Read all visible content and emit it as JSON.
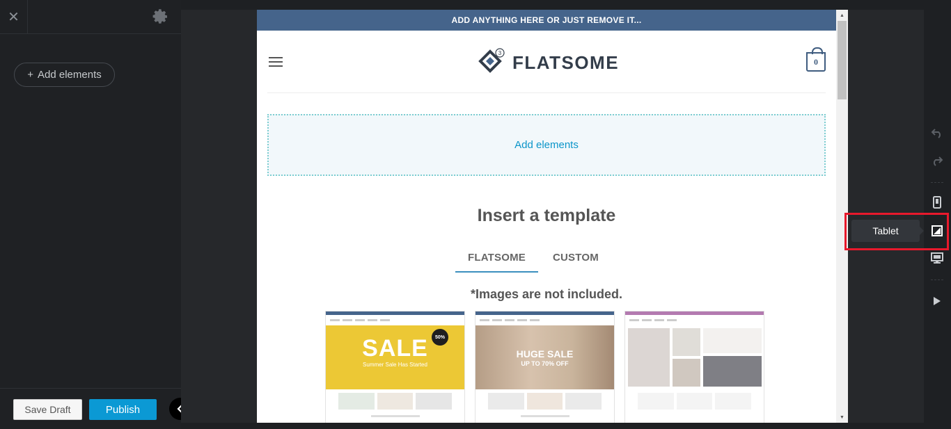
{
  "sidebar": {
    "close_icon": "close-icon",
    "settings_icon": "gear-icon",
    "add_elements_label": "Add elements",
    "save_draft_label": "Save Draft",
    "publish_label": "Publish",
    "collapse_icon": "chevron-left-icon"
  },
  "preview": {
    "topbar_text": "ADD ANYTHING HERE OR JUST REMOVE IT...",
    "logo_text": "FLATSOME",
    "logo_badge": "3",
    "cart_count": "0",
    "dropzone_label": "Add elements",
    "template_title": "Insert a template",
    "tabs": [
      {
        "label": "FLATSOME",
        "active": true
      },
      {
        "label": "CUSTOM",
        "active": false
      }
    ],
    "note": "*Images are not included.",
    "thumbnails": [
      {
        "hero_text": "SALE",
        "hero_sub": "Summer Sale Has Started",
        "badge": "50%"
      },
      {
        "hero_text": "HUGE SALE",
        "hero_sub": "UP TO 70% OFF"
      },
      {
        "hero_text": ""
      }
    ]
  },
  "right_toolbar": {
    "icons": [
      "undo-icon",
      "redo-icon",
      "mobile-icon",
      "tablet-icon",
      "desktop-icon",
      "play-icon"
    ],
    "tooltip": "Tablet"
  },
  "colors": {
    "publish": "#0b99d4",
    "topbar": "#45648b",
    "highlight": "#e8192c",
    "dropzone_border": "#7ccdd0"
  }
}
